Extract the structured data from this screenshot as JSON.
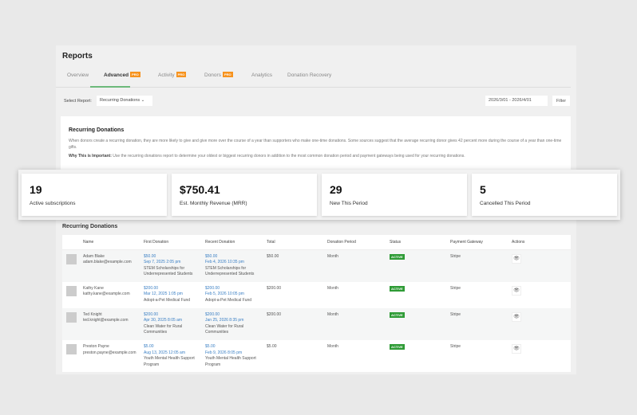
{
  "page": {
    "title": "Reports"
  },
  "tabs": [
    {
      "label": "Overview"
    },
    {
      "label": "Advanced",
      "badge": "PRO"
    },
    {
      "label": "Activity",
      "badge": "PRO"
    },
    {
      "label": "Donors",
      "badge": "PRO"
    },
    {
      "label": "Analytics"
    },
    {
      "label": "Donation Recovery"
    }
  ],
  "toolbar": {
    "select_label": "Select Report:",
    "select_value": "Recurring Donations",
    "date_range": "2026/3/01 - 2026/4/01",
    "filter_label": "Filter"
  },
  "info": {
    "title": "Recurring Donations",
    "body": "When donors create a recurring donation, they are more likely to give and give more over the course of a year than supporters who make one-time donations. Some sources suggest that the average recurring donor gives 42 percent more during the course of a year than one-time gifts.",
    "why_label": "Why This is Important:",
    "why_text": " Use the recurring donations report to determine your oldest or biggest recurring donors in addition to the most common donation period and payment gateways being used for your recurring donations."
  },
  "stats": [
    {
      "value": "19",
      "label": "Active subscriptions"
    },
    {
      "value": "$750.41",
      "label": "Est. Monthly Revenue (MRR)"
    },
    {
      "value": "29",
      "label": "New This Period"
    },
    {
      "value": "5",
      "label": "Cancelled This Period"
    }
  ],
  "table": {
    "title": "Recurring Donations",
    "columns": [
      "Name",
      "First Donation",
      "Recent Donation",
      "Total",
      "Donation Period",
      "Status",
      "Payment Gateway",
      "Actions"
    ],
    "rows": [
      {
        "name": "Adam Blake",
        "email": "adam.blake@example.com",
        "first_amount": "$50.00",
        "first_date": "Sep 7, 2025 2:05 pm",
        "first_fund": "STEM Scholarships for Underrepresented Students",
        "recent_amount": "$50.00",
        "recent_date": "Feb 4, 2026 10:35 pm",
        "recent_fund": "STEM Scholarships for Underrepresented Students",
        "total": "$50.00",
        "period": "Month",
        "status": "ACTIVE",
        "gateway": "Stripe"
      },
      {
        "name": "Kathy Kane",
        "email": "kathy.kane@example.com",
        "first_amount": "$200.00",
        "first_date": "Mar 12, 2025 1:05 pm",
        "first_fund": "Adopt-a-Pet Medical Fund",
        "recent_amount": "$200.00",
        "recent_date": "Feb 5, 2026 10:05 pm",
        "recent_fund": "Adopt-a-Pet Medical Fund",
        "total": "$200.00",
        "period": "Month",
        "status": "ACTIVE",
        "gateway": "Stripe"
      },
      {
        "name": "Ted Knight",
        "email": "ted.knight@example.com",
        "first_amount": "$200.00",
        "first_date": "Apr 30, 2025 8:05 am",
        "first_fund": "Clean Water for Rural Communities",
        "recent_amount": "$200.00",
        "recent_date": "Jan 25, 2026 8:35 pm",
        "recent_fund": "Clean Water for Rural Communities",
        "total": "$200.00",
        "period": "Month",
        "status": "ACTIVE",
        "gateway": "Stripe"
      },
      {
        "name": "Preston Payne",
        "email": "preston.payne@example.com",
        "first_amount": "$5.00",
        "first_date": "Aug 13, 2025 12:05 am",
        "first_fund": "Youth Mental Health Support Program",
        "recent_amount": "$5.00",
        "recent_date": "Feb 9, 2026 8:05 pm",
        "recent_fund": "Youth Mental Health Support Program",
        "total": "$5.00",
        "period": "Month",
        "status": "ACTIVE",
        "gateway": "Stripe"
      }
    ]
  },
  "colors": {
    "accent": "#6cb97a",
    "pro_badge": "#f7931e",
    "active_badge": "#2e9b35",
    "link": "#3a7fc4"
  }
}
